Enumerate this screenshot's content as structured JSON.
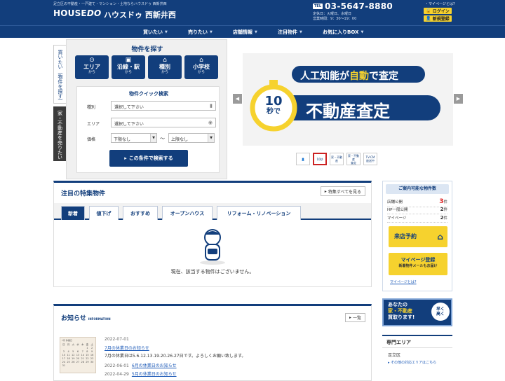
{
  "header": {
    "tagline": "足立区の不動産・一戸建て・マンション・土地ならハウスドゥ 西新井西",
    "logo_en": "HOUSE",
    "logo_en2": "DO",
    "logo_kana": "ハウスドゥ",
    "store_name": "西新井西",
    "tel_badge": "TEL",
    "tel": "03-5647-8880",
    "holiday": "定休日：火曜日、水曜日",
    "hours": "営業時間：9：30～19：00",
    "mypage_label": "・マイページとは?",
    "login_label": "ログイン",
    "register_label": "新規登録"
  },
  "nav": {
    "items": [
      "買いたい",
      "売りたい",
      "店舗情報",
      "注目物件",
      "お気に入りBOX"
    ]
  },
  "side_tabs": {
    "buy": "買いたい（物件を探す）",
    "sell": "家・不動産を売りたい"
  },
  "search": {
    "title": "物件を探す",
    "buttons": [
      {
        "label": "エリア",
        "sub": "から",
        "icon": "⊙"
      },
      {
        "label": "沿線・駅",
        "sub": "から",
        "icon": "▣"
      },
      {
        "label": "種別",
        "sub": "から",
        "icon": "⌂"
      },
      {
        "label": "小学校",
        "sub": "から",
        "icon": "⌂"
      }
    ],
    "quick_title": "物件クイック検索",
    "type_label": "種別",
    "type_placeholder": "選択して下さい",
    "area_label": "エリア",
    "area_placeholder": "選択して下さい",
    "price_label": "価格",
    "price_min": "下限なし",
    "price_max": "上限なし",
    "tilde": "～",
    "submit": "この条件で検索する"
  },
  "banner": {
    "headline_pre": "人工知能が",
    "headline_mid": "自動",
    "headline_post": "で査定",
    "badge_num": "10",
    "badge_unit": "秒で",
    "main_text": "不動産査定",
    "thumbs": [
      "",
      "10秒",
      "家・不動産",
      "家・不動産\n査定",
      "TV-CM\n放送中"
    ]
  },
  "featured": {
    "title": "注目の特集物件",
    "see_all": "特集すべてを見る",
    "tabs": [
      "新着",
      "値下げ",
      "おすすめ",
      "オープンハウス",
      "リフォーム・リノベーション"
    ],
    "empty": "現在、該当する物件はございません。"
  },
  "info": {
    "title": "お知らせ",
    "subtitle": "INFORMATION",
    "list_button": "一覧",
    "calendar_header": "7月 休業日",
    "calendar_days": [
      "日",
      "月",
      "火",
      "水",
      "木",
      "金",
      "土",
      "",
      "",
      "",
      "",
      "",
      "1",
      "2",
      "3",
      "4",
      "5",
      "6",
      "7",
      "8",
      "9",
      "10",
      "11",
      "12",
      "13",
      "14",
      "15",
      "16",
      "17",
      "18",
      "19",
      "20",
      "21",
      "22",
      "23",
      "24",
      "25",
      "26",
      "27",
      "28",
      "29",
      "30",
      "31"
    ],
    "news": [
      {
        "date": "2022-07-01",
        "title": "7月の休業日のお知らせ",
        "body": "7月の休業日は5.6.12.13.19.20.26.27日です。よろしくお願い致します。"
      },
      {
        "date": "2022-06-01",
        "title": "6月の休業日のお知らせ"
      },
      {
        "date": "2022-04-29",
        "title": "5月の休業日のお知らせ"
      }
    ]
  },
  "sidebar": {
    "count_title": "ご案内可能な物件数",
    "counts": [
      {
        "label": "店舗公開",
        "value": "3",
        "unit": "件"
      },
      {
        "label": "HP一般公開",
        "value": "2",
        "unit": "件"
      },
      {
        "label": "マイページ",
        "value": "2",
        "unit": "件"
      }
    ],
    "reserve": "来店予約",
    "mypage_reg": "マイページ登録",
    "mypage_sub": "新着物件メールもお届け",
    "mypage_link": "マイページとは?",
    "ad_line1": "あなたの",
    "ad_line2": "家・不動産",
    "ad_line3": "買取ります!",
    "ad_circle": "早く\n高く",
    "area_title": "専門エリア",
    "area_item": "足立区",
    "area_link": "その他の対応エリアはこちら"
  },
  "colors": {
    "primary": "#123e7c",
    "accent": "#f6d22e",
    "alert": "#d22222"
  }
}
